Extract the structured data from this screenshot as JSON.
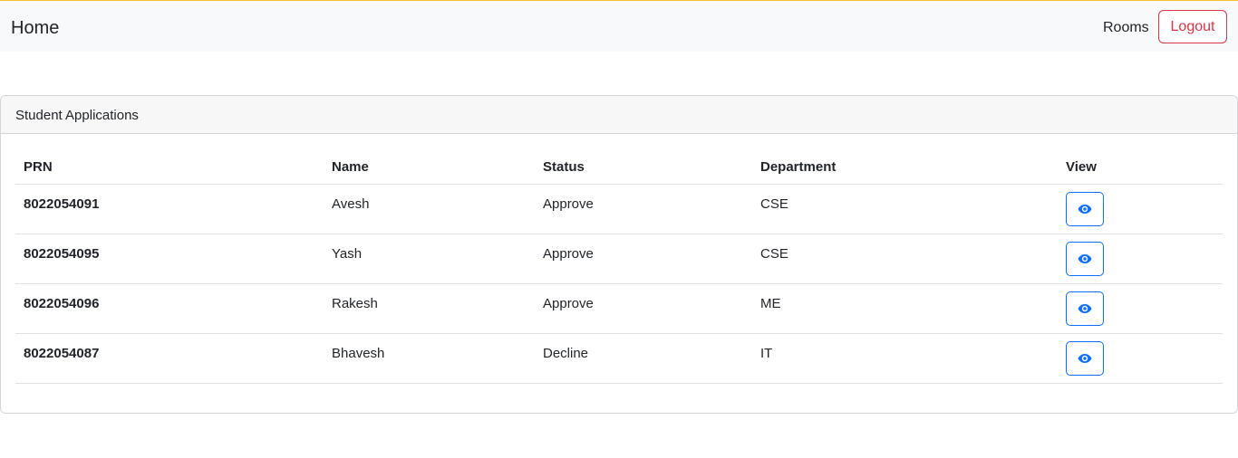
{
  "navbar": {
    "brand": "Home",
    "links": [
      "Rooms"
    ],
    "logout_label": "Logout"
  },
  "card": {
    "title": "Student Applications"
  },
  "table": {
    "columns": [
      "PRN",
      "Name",
      "Status",
      "Department",
      "View"
    ],
    "rows": [
      {
        "prn": "8022054091",
        "name": "Avesh",
        "status": "Approve",
        "department": "CSE",
        "view_icon": "eye-icon"
      },
      {
        "prn": "8022054095",
        "name": "Yash",
        "status": "Approve",
        "department": "CSE",
        "view_icon": "eye-icon"
      },
      {
        "prn": "8022054096",
        "name": "Rakesh",
        "status": "Approve",
        "department": "ME",
        "view_icon": "eye-icon"
      },
      {
        "prn": "8022054087",
        "name": "Bhavesh",
        "status": "Decline",
        "department": "IT",
        "view_icon": "eye-icon"
      }
    ]
  },
  "colors": {
    "accent_top_border": "#f1c232",
    "navbar_bg": "#f8f9fa",
    "danger": "#dc3545",
    "primary": "#0d6efd",
    "card_header_bg": "#f7f7f7",
    "border": "#dee2e6"
  }
}
